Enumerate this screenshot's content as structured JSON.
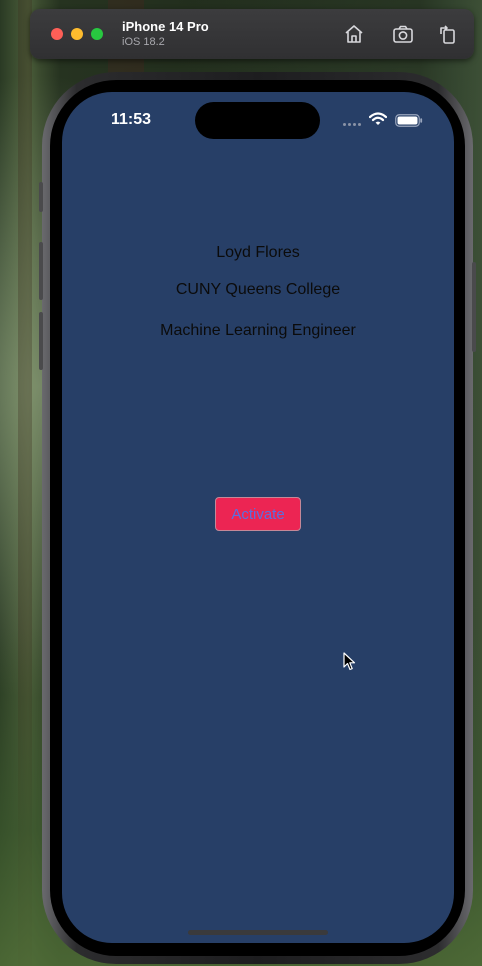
{
  "simulator": {
    "device_name": "iPhone 14 Pro",
    "os_version": "iOS 18.2",
    "buttons": [
      "home-icon",
      "screenshot-icon",
      "rotate-icon"
    ]
  },
  "status_bar": {
    "time": "11:53"
  },
  "profile": {
    "name": "Loyd Flores",
    "school": "CUNY Queens College",
    "role": "Machine Learning Engineer"
  },
  "actions": {
    "activate_label": "Activate"
  },
  "colors": {
    "screen_bg": "#273f67",
    "button_bg": "#ec2553",
    "button_text": "#5a6fe0"
  }
}
